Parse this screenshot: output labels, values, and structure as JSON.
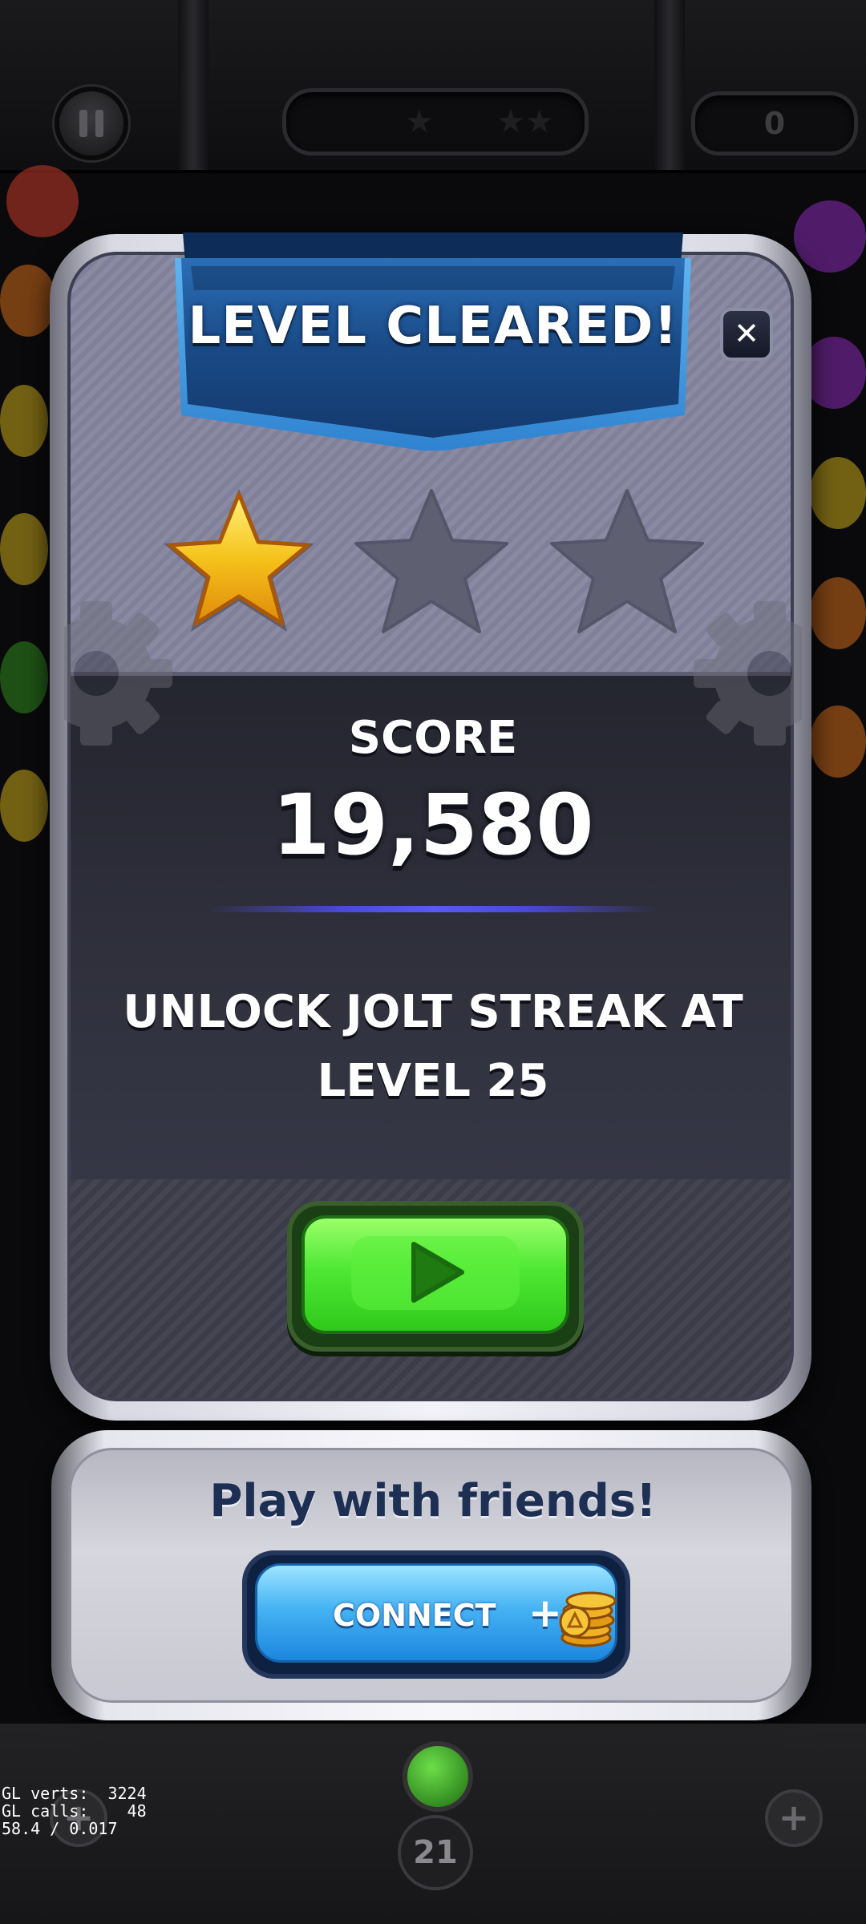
{
  "hud": {
    "pause_icon": "pause-icon",
    "stars_icon": "star-icon",
    "score": "0"
  },
  "dialog": {
    "title": "LEVEL CLEARED!",
    "close_label": "✕",
    "stars_earned": 1,
    "stars_total": 3,
    "score_label": "SCORE",
    "score_value": "19,580",
    "unlock_text": "UNLOCK JOLT STREAK AT LEVEL 25",
    "play_icon": "play-icon",
    "colors": {
      "banner": "#1d4e86",
      "play": "#4ee834",
      "star": "#f5c21b"
    }
  },
  "friends": {
    "title": "Play with friends!",
    "connect_label": "CONNECT",
    "plus": "+",
    "reward_icon": "coins-icon",
    "colors": {
      "title": "#1d3054",
      "button": "#46b3f4"
    }
  },
  "bottom": {
    "shots_left": "21",
    "left_plus": "+",
    "right_plus": "+"
  },
  "debug": {
    "line1": "GL verts:  3224",
    "line2": "GL calls:    48",
    "line3": "58.4 / 0.017"
  }
}
